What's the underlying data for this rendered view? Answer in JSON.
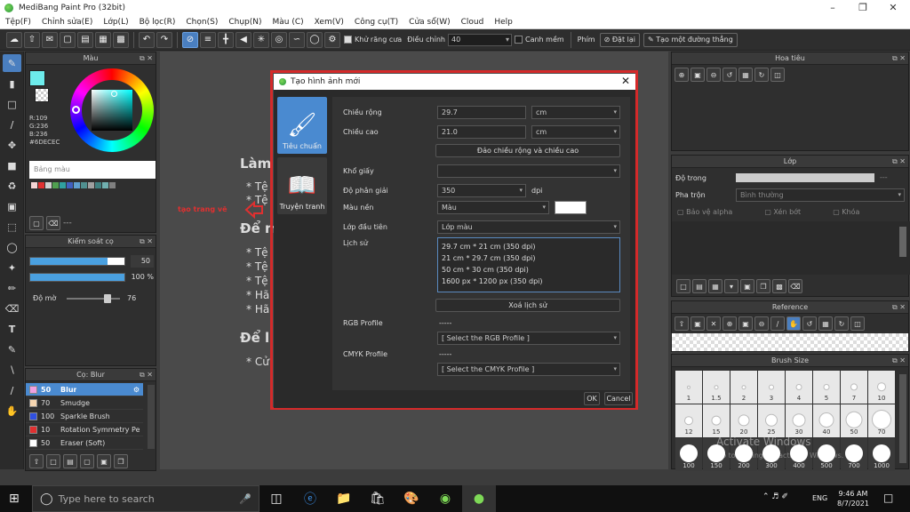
{
  "window": {
    "title": "MediBang Paint Pro (32bit)"
  },
  "menu": [
    "Tệp(F)",
    "Chỉnh sửa(E)",
    "Lớp(L)",
    "Bộ lọc(R)",
    "Chọn(S)",
    "Chụp(N)",
    "Màu (C)",
    "Xem(V)",
    "Công cụ(T)",
    "Cửa sổ(W)",
    "Cloud",
    "Help"
  ],
  "toolbar": {
    "antialias_label": "Khử răng cưa",
    "adjust_label": "Điều chỉnh",
    "adjust_value": "40",
    "snap_label": "Canh mềm",
    "key_label": "Phím",
    "reset_label": "Đặt lại",
    "straight_label": "Tạo một đường thẳng"
  },
  "color_panel": {
    "title": "Màu",
    "r": "R:109",
    "g": "G:236",
    "b": "B:236",
    "hex": "#6DECEC",
    "palette_label": "Bảng màu",
    "palette_dashes": "---"
  },
  "control_panel": {
    "title": "Kiểm soát cọ",
    "size_value": "50",
    "size_fill": 0.82,
    "opacity_value": "100 %",
    "opacity_fill": 1.0,
    "blur_label": "Độ mờ",
    "blur_value": "76",
    "blur_fill": 0.76
  },
  "brush_panel": {
    "title": "Cọ: Blur",
    "items": [
      {
        "size": "50",
        "name": "Blur",
        "color": "#f0a0e0",
        "selected": true
      },
      {
        "size": "70",
        "name": "Smudge",
        "color": "#f5d5b0",
        "selected": false
      },
      {
        "size": "100",
        "name": "Sparkle Brush",
        "color": "#3050e0",
        "selected": false
      },
      {
        "size": "10",
        "name": "Rotation Symmetry Pe",
        "color": "#e03030",
        "selected": false
      },
      {
        "size": "50",
        "name": "Eraser (Soft)",
        "color": "#ffffff",
        "selected": false
      }
    ]
  },
  "canvas_doc": {
    "heading1": "Làm",
    "heading2": "Để m",
    "heading3": "Để l",
    "bullets1": [
      "* Tệ",
      "* Tệ"
    ],
    "bullets2": [
      "* Tệ",
      "* Tệ",
      "* Tệ",
      "* Hã",
      "* Hã"
    ],
    "bullets3": [
      "* Cử"
    ],
    "annotation": "tạo trang vẽ"
  },
  "dialog": {
    "title": "Tạo hình ảnh mới",
    "side": [
      {
        "label": "Tiêu chuẩn",
        "active": true
      },
      {
        "label": "Truyện tranh",
        "active": false
      }
    ],
    "width_label": "Chiều rộng",
    "width_value": "29.7",
    "width_unit": "cm",
    "height_label": "Chiều cao",
    "height_value": "21.0",
    "height_unit": "cm",
    "swap_button": "Đảo chiều rộng và chiều cao",
    "paper_label": "Khổ giấy",
    "paper_value": "",
    "res_label": "Độ phân giải",
    "res_value": "350",
    "res_unit": "dpi",
    "bg_label": "Màu nền",
    "bg_value": "Màu",
    "first_layer_label": "Lớp đầu tiên",
    "first_layer_value": "Lớp màu",
    "history_label": "Lịch sử",
    "history": [
      "29.7 cm * 21 cm (350 dpi)",
      "21 cm * 29.7 cm (350 dpi)",
      "50 cm * 30 cm (350 dpi)",
      "1600 px * 1200 px (350 dpi)"
    ],
    "clear_history": "Xoá lịch sử",
    "rgb_label": "RGB Profile",
    "rgb_dash": "-----",
    "rgb_value": "[ Select the RGB Profile ]",
    "cmyk_label": "CMYK Profile",
    "cmyk_dash": "-----",
    "cmyk_value": "[ Select the CMYK Profile ]",
    "ok": "OK",
    "cancel": "Cancel"
  },
  "right": {
    "navigator_title": "Hoa tiêu",
    "layer_title": "Lớp",
    "opacity_label": "Độ trong",
    "opacity_dashes": "---",
    "blend_label": "Pha trộn",
    "blend_value": "Bình thường",
    "protect_alpha": "Bảo vệ alpha",
    "clip": "Xén bớt",
    "lock": "Khóa",
    "reference_title": "Reference",
    "brushsize_title": "Brush Size",
    "sizes": [
      "1",
      "1.5",
      "2",
      "3",
      "4",
      "5",
      "7",
      "10",
      "12",
      "15",
      "20",
      "25",
      "30",
      "40",
      "50",
      "70",
      "100",
      "150",
      "200",
      "300",
      "400",
      "500",
      "700",
      "1000"
    ]
  },
  "taskbar": {
    "search_placeholder": "Type here to search",
    "lang": "ENG",
    "time": "9:46 AM",
    "date": "8/7/2021"
  },
  "watermark": {
    "line1": "Activate Windows",
    "line2": "Go to Settings to activate Windows."
  }
}
